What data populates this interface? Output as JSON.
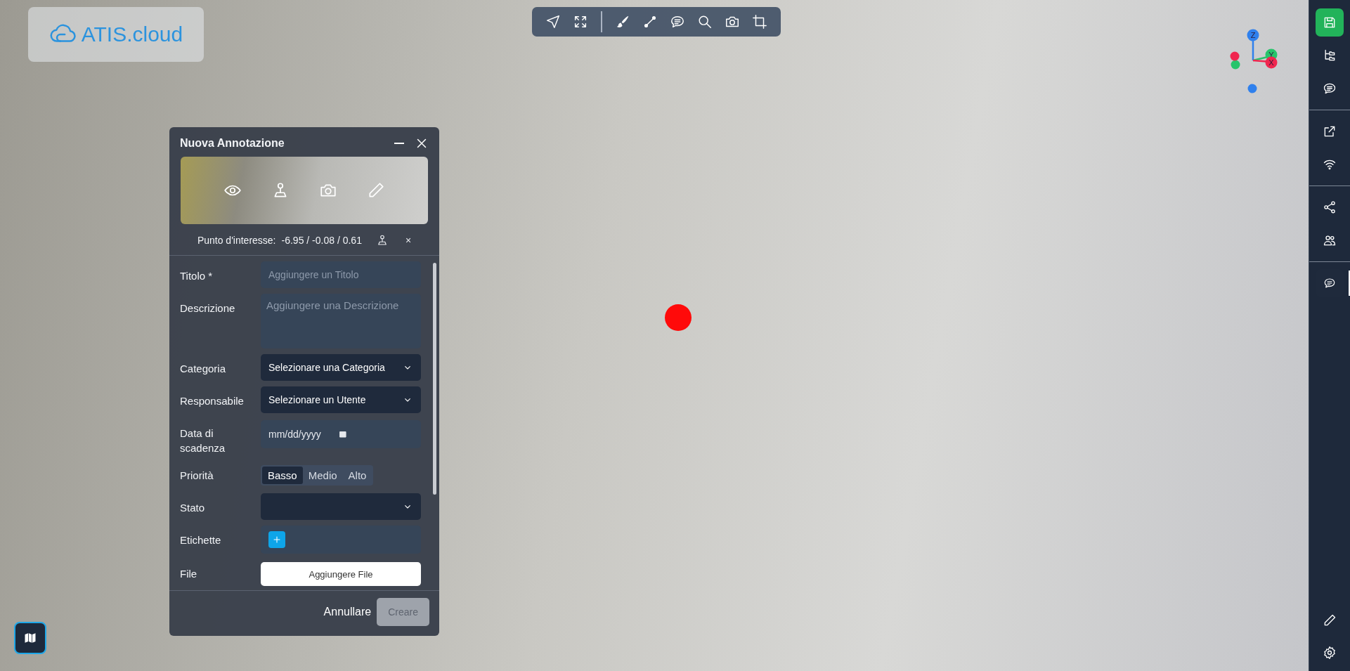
{
  "logo": {
    "text": "ATIS.cloud"
  },
  "toolbar": {
    "tools": [
      {
        "kind": "navigate"
      },
      {
        "kind": "fit"
      },
      {
        "kind": "divider"
      },
      {
        "kind": "brush"
      },
      {
        "kind": "measure"
      },
      {
        "kind": "comment"
      },
      {
        "kind": "search"
      },
      {
        "kind": "camera"
      },
      {
        "kind": "crop"
      }
    ]
  },
  "gizmo": {
    "axes": [
      {
        "label": "Z",
        "color": "#2f80ed"
      },
      {
        "label": "Y",
        "color": "#27c46b"
      },
      {
        "label": "X",
        "color": "#f0264f"
      }
    ]
  },
  "sidebar": {
    "groups": [
      [
        {
          "kind": "save",
          "selected": false
        },
        {
          "kind": "folders",
          "selected": false
        },
        {
          "kind": "comment",
          "selected": false
        }
      ],
      [
        {
          "kind": "external",
          "selected": false
        },
        {
          "kind": "wifi",
          "selected": false
        }
      ],
      [
        {
          "kind": "share",
          "selected": false
        },
        {
          "kind": "users",
          "selected": false
        }
      ],
      [
        {
          "kind": "comment",
          "selected": true
        }
      ]
    ],
    "bottom": [
      {
        "kind": "pencil",
        "selected": false
      },
      {
        "kind": "gear",
        "selected": false
      }
    ]
  },
  "dialog": {
    "title": "Nuova Annotazione",
    "point_label": "Punto d'interesse:",
    "point_value": "-6.95 / -0.08 / 0.61",
    "point_clear": "×",
    "fields": [
      {
        "kind": "text",
        "label": "Titolo *",
        "placeholder": "Aggiungere un Titolo"
      },
      {
        "kind": "textarea",
        "label": "Descrizione",
        "placeholder": "Aggiungere una Descrizione"
      },
      {
        "kind": "select",
        "label": "Categoria",
        "value": "Selezionare una Categoria"
      },
      {
        "kind": "select",
        "label": "Responsabile",
        "value": "Selezionare un Utente"
      },
      {
        "kind": "date",
        "label": "Data di scadenza",
        "placeholder": "mm/dd/yyyy"
      },
      {
        "kind": "segmented",
        "label": "Priorità",
        "options": [
          {
            "label": "Basso",
            "selected": true
          },
          {
            "label": "Medio",
            "selected": false
          },
          {
            "label": "Alto",
            "selected": false
          }
        ]
      },
      {
        "kind": "select",
        "label": "Stato"
      },
      {
        "kind": "tags",
        "label": "Etichette"
      },
      {
        "kind": "file",
        "label": "File",
        "button": "Aggiungere File"
      }
    ],
    "cancel": "Annullare",
    "create": {
      "label": "Creare",
      "disabled": true
    }
  }
}
